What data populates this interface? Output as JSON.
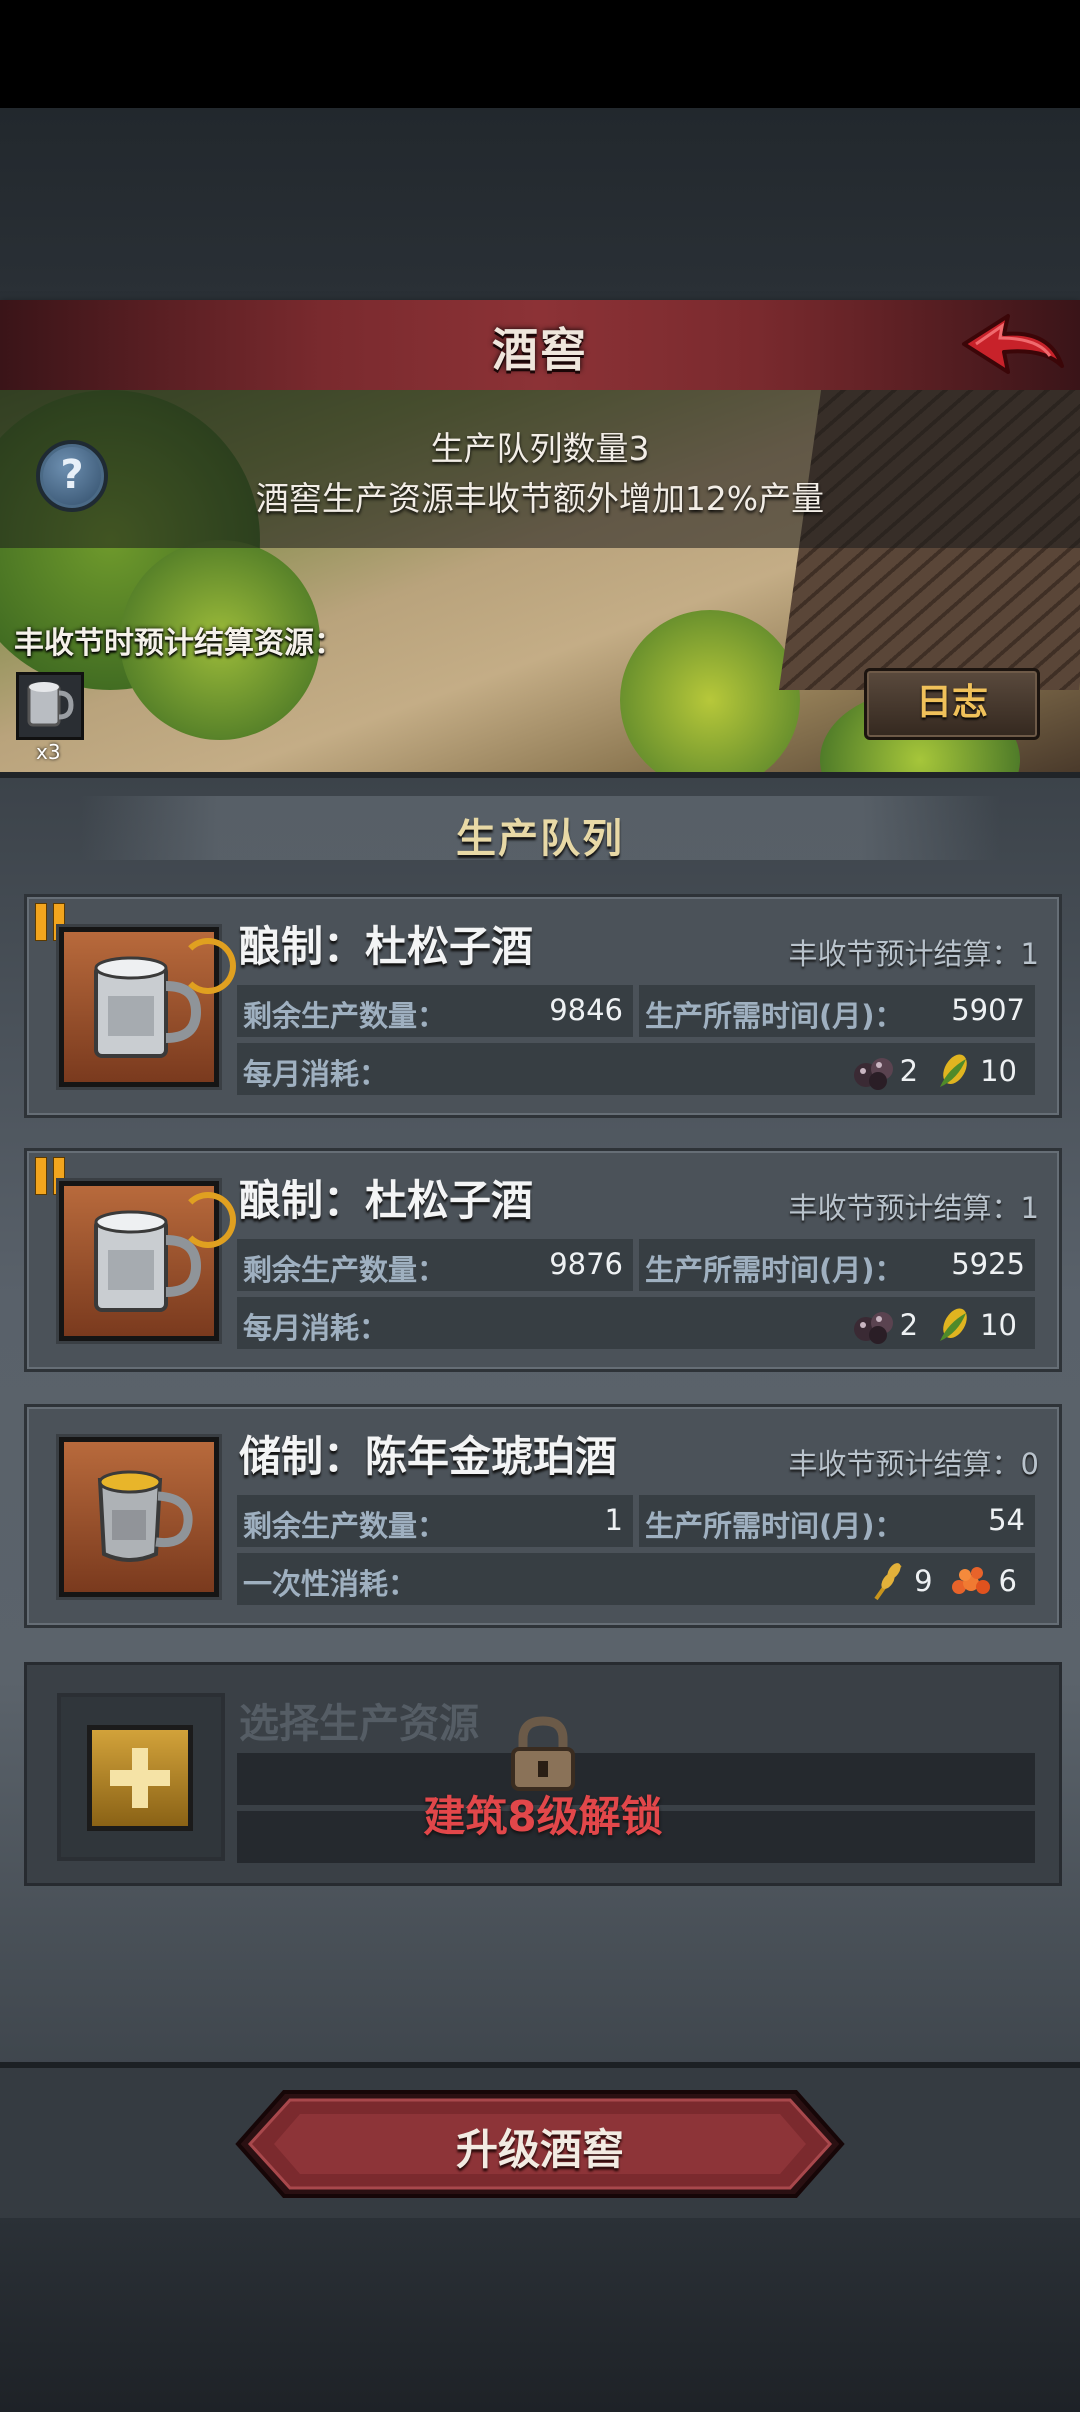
{
  "header": {
    "title": "酒窖"
  },
  "info": {
    "line1": "生产队列数量3",
    "line2": "酒窖生产资源丰收节额外增加12%产量",
    "harvest_label": "丰收节时预计结算资源：",
    "harvest_item_count": "x3",
    "log_button": "日志"
  },
  "queue": {
    "title": "生产队列",
    "items": [
      {
        "title": "酿制：杜松子酒",
        "settle": "丰收节预计结算：1",
        "remaining_label": "剩余生产数量：",
        "remaining": "9846",
        "time_label": "生产所需时间(月)：",
        "time": "5907",
        "cost_label": "每月消耗：",
        "cost1": "2",
        "cost2": "10",
        "paused": true,
        "cost_icons": [
          "berries-icon",
          "corn-icon"
        ]
      },
      {
        "title": "酿制：杜松子酒",
        "settle": "丰收节预计结算：1",
        "remaining_label": "剩余生产数量：",
        "remaining": "9876",
        "time_label": "生产所需时间(月)：",
        "time": "5925",
        "cost_label": "每月消耗：",
        "cost1": "2",
        "cost2": "10",
        "paused": true,
        "cost_icons": [
          "berries-icon",
          "corn-icon"
        ]
      },
      {
        "title": "储制：陈年金琥珀酒",
        "settle": "丰收节预计结算：0",
        "remaining_label": "剩余生产数量：",
        "remaining": "1",
        "time_label": "生产所需时间(月)：",
        "time": "54",
        "cost_label": "一次性消耗：",
        "cost1": "9",
        "cost2": "6",
        "paused": false,
        "cost_icons": [
          "wheat-icon",
          "roe-icon"
        ]
      }
    ],
    "locked_slot": {
      "title": "选择生产资源",
      "unlock_text": "建筑8级解锁"
    }
  },
  "upgrade": {
    "label": "升级酒窖"
  },
  "colors": {
    "header_red": "#8c3236",
    "accent_gold": "#f0c15a",
    "lock_red": "#e2474a"
  }
}
